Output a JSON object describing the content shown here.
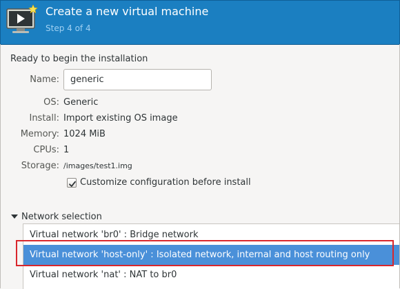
{
  "header": {
    "title": "Create a new virtual machine",
    "subtitle": "Step 4 of 4",
    "icon": "virtual-machine-icon"
  },
  "main": {
    "heading": "Ready to begin the installation",
    "name_label": "Name:",
    "name_value": "generic",
    "details": [
      {
        "label": "OS:",
        "value": "Generic"
      },
      {
        "label": "Install:",
        "value": "Import existing OS image"
      },
      {
        "label": "Memory:",
        "value": "1024 MiB"
      },
      {
        "label": "CPUs:",
        "value": "1"
      },
      {
        "label": "Storage:",
        "value": "/images/test1.img"
      }
    ],
    "customize_checkbox": {
      "label": "Customize configuration before install",
      "checked": true
    }
  },
  "network": {
    "expander_label": "Network selection",
    "expanded": true,
    "options": [
      {
        "label": "Virtual network 'br0' : Bridge network",
        "selected": false
      },
      {
        "label": "Virtual network 'host-only' : Isolated network, internal and host routing only",
        "selected": true
      },
      {
        "label": "Virtual network 'nat' : NAT to br0",
        "selected": false
      }
    ]
  },
  "colors": {
    "header_bg": "#1b7fc1",
    "selection_bg": "#4a90d9",
    "annotation_box": "#d9262c"
  }
}
